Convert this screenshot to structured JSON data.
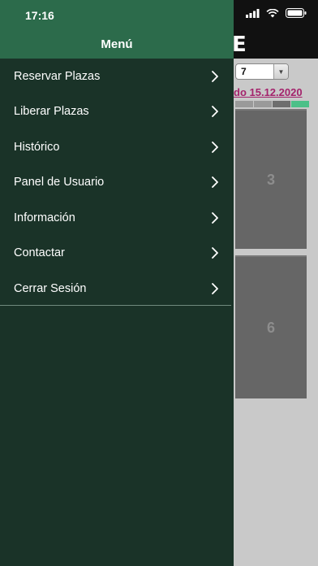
{
  "status_bar": {
    "time": "17:16"
  },
  "drawer": {
    "title": "Menú",
    "items": [
      {
        "label": "Reservar Plazas",
        "icon": "chevron-right-icon"
      },
      {
        "label": "Liberar Plazas",
        "icon": "chevron-right-icon"
      },
      {
        "label": "Histórico",
        "icon": "chevron-right-icon"
      },
      {
        "label": "Panel de Usuario",
        "icon": "chevron-right-icon"
      },
      {
        "label": "Información",
        "icon": "chevron-right-icon"
      },
      {
        "label": "Contactar",
        "icon": "chevron-right-icon"
      },
      {
        "label": "Cerrar Sesión",
        "icon": "chevron-right-icon"
      }
    ]
  },
  "background_screen": {
    "title_fragment": "E",
    "select_value": "7",
    "date_link": "do 15.12.2020",
    "slots": [
      "3",
      "6"
    ]
  },
  "colors": {
    "drawer_bg": "#1a3328",
    "drawer_header": "#2c6b4b",
    "date_link": "#a4236c",
    "slot_bg": "#666666",
    "slot_free_marker": "#4cc088"
  }
}
